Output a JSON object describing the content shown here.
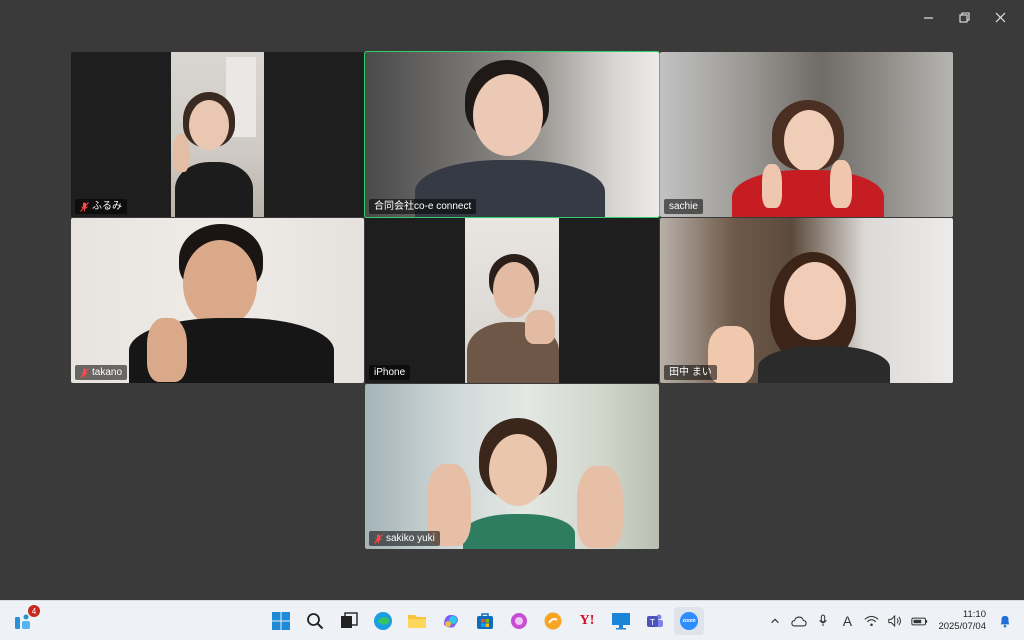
{
  "window_controls": {
    "minimize": "—",
    "restore": "❐",
    "close": "✕"
  },
  "participants": [
    {
      "name": "ふるみ",
      "muted": true
    },
    {
      "name": "合同会社co-e connect",
      "muted": false,
      "speaking": true
    },
    {
      "name": "sachie",
      "muted": false
    },
    {
      "name": "takano",
      "muted": true
    },
    {
      "name": "iPhone",
      "muted": false
    },
    {
      "name": "田中 まい",
      "muted": false
    },
    {
      "name": "sakiko yuki",
      "muted": true
    }
  ],
  "taskbar": {
    "widgets_badge": "4",
    "apps": [
      {
        "name": "start-button"
      },
      {
        "name": "search"
      },
      {
        "name": "task-view"
      },
      {
        "name": "edge"
      },
      {
        "name": "file-explorer"
      },
      {
        "name": "copilot"
      },
      {
        "name": "microsoft-store"
      },
      {
        "name": "copilot-app"
      },
      {
        "name": "orange-app"
      },
      {
        "name": "yahoo"
      },
      {
        "name": "remote-desktop"
      },
      {
        "name": "teams"
      },
      {
        "name": "zoom"
      }
    ],
    "zoom_label": "zoom",
    "yahoo_label": "Y!",
    "font_icon_label": "A",
    "time": "11:10",
    "date": "2025/07/04"
  }
}
